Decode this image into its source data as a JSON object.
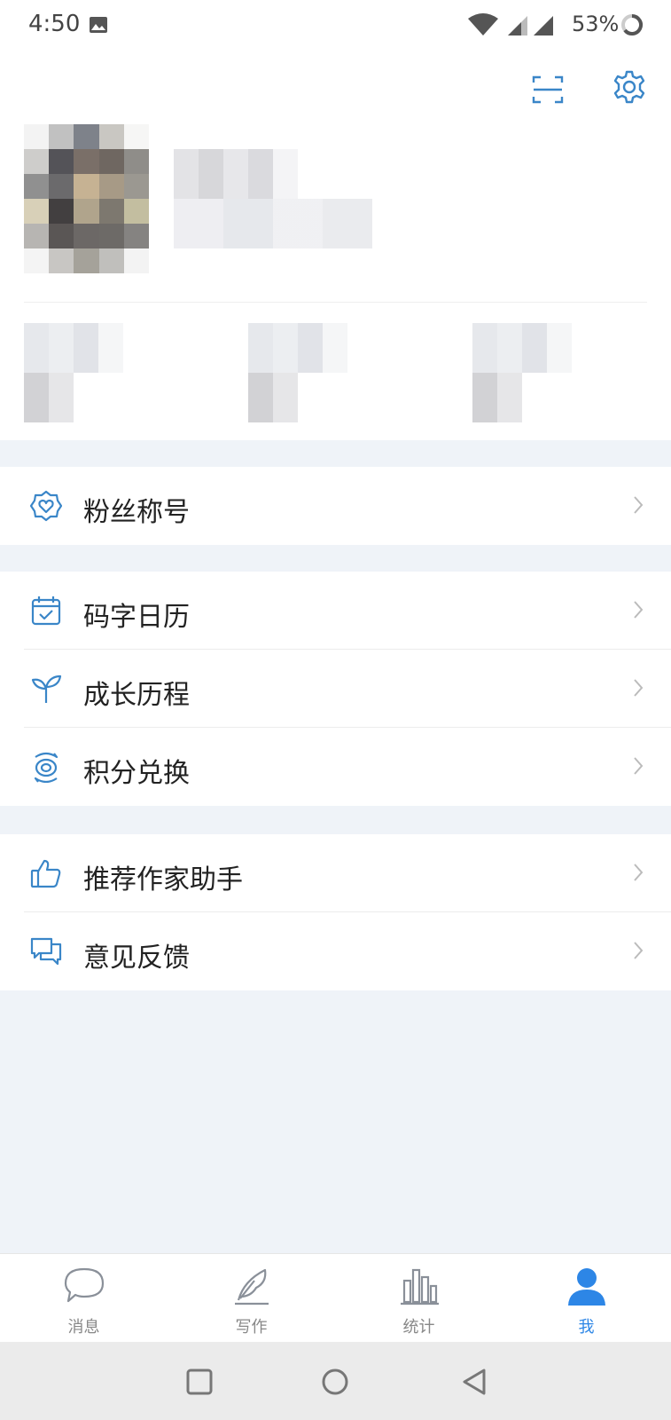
{
  "status_bar": {
    "time": "4:50",
    "battery_percent": "53%"
  },
  "header": {
    "scan_icon": "scan-icon",
    "settings_icon": "gear-icon"
  },
  "menu_groups": [
    [
      {
        "label": "粉丝称号",
        "icon": "badge-heart-icon"
      }
    ],
    [
      {
        "label": "码字日历",
        "icon": "calendar-check-icon"
      },
      {
        "label": "成长历程",
        "icon": "sprout-icon"
      },
      {
        "label": "积分兑换",
        "icon": "exchange-coin-icon"
      }
    ],
    [
      {
        "label": "推荐作家助手",
        "icon": "thumbs-up-icon"
      },
      {
        "label": "意见反馈",
        "icon": "chat-bubbles-icon"
      }
    ]
  ],
  "tabs": [
    {
      "label": "消息",
      "icon": "message-bubble-icon",
      "active": false
    },
    {
      "label": "写作",
      "icon": "feather-pen-icon",
      "active": false
    },
    {
      "label": "统计",
      "icon": "bar-chart-icon",
      "active": false
    },
    {
      "label": "我",
      "icon": "person-icon",
      "active": true
    }
  ],
  "colors": {
    "accent": "#2d86e6",
    "icon_blue": "#3a86c8",
    "background": "#eff3f8"
  }
}
